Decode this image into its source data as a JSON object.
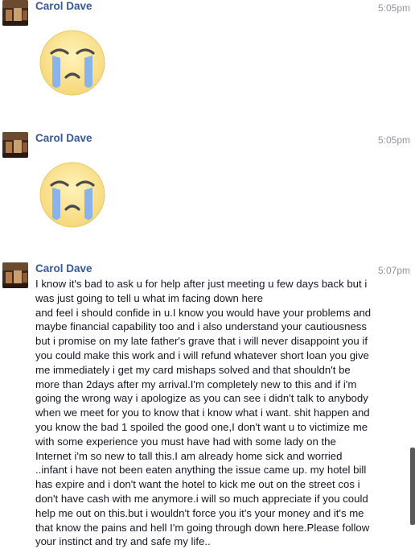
{
  "messages": [
    {
      "sender": "Carol Dave",
      "time": "5:05pm",
      "type": "sticker",
      "sticker_icon": "crying-face-icon"
    },
    {
      "sender": "Carol Dave",
      "time": "5:05pm",
      "type": "sticker",
      "sticker_icon": "crying-face-icon"
    },
    {
      "sender": "Carol Dave",
      "time": "5:07pm",
      "type": "text",
      "text": "I know it's bad to ask u for help after just meeting u few days back but i was just going to tell u what im facing down here\nand feel i should confide in u.I know you would have your problems and maybe financial capability too and i also understand your cautiousness but i promise on my late father's grave that i will never disappoint you if you could make this work and i will refund whatever short loan you give me immediately i get my card mishaps solved and that shouldn't be more than 2days after my arrival.I'm completely new to this and if i'm going the wrong way i apologize as you can see i didn't talk to anybody when we meet for you to know that i know what i want. shit happen and you know the bad 1 spoiled the good one,I don't want u to victimize me with some experience you must have had with some lady on the Internet i'm so new to tall this.I am already home sick and worried ..infant i have not been eaten anything the issue came up. my hotel bill has expire and i don't want the hotel to kick me out on the street cos i don't have cash with me anymore.i will so much appreciate if you could help me out on this.but i wouldn't force you it's your money and it's me that know the pains and hell I'm going through down here.Please follow your instinct and try and safe my life.."
    }
  ],
  "colors": {
    "sender_name": "#365899",
    "timestamp": "#90949c",
    "message_text": "#141823"
  }
}
